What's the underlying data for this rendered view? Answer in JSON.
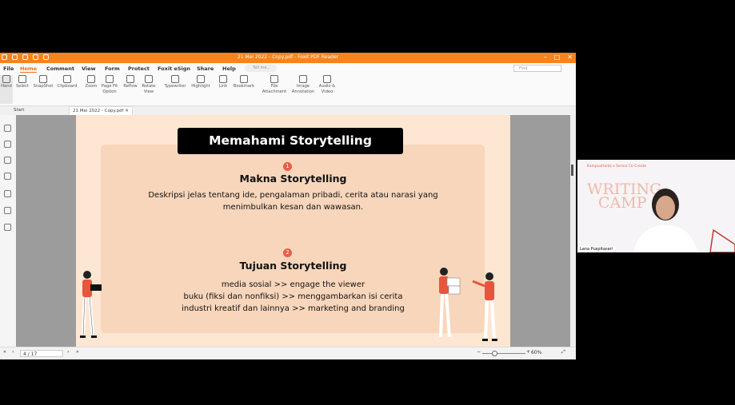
{
  "window": {
    "title": "21 Mei 2022 - Copy.pdf - Foxit PDF Reader"
  },
  "menu": {
    "items": [
      "File",
      "Home",
      "Comment",
      "View",
      "Form",
      "Protect",
      "Foxit eSign",
      "Share",
      "Help"
    ],
    "tell_me": "Tell me...",
    "find": "Find"
  },
  "ribbon": {
    "hand": "Hand",
    "select": "Select",
    "snapshot": "SnapShot",
    "clipboard": "Clipboard",
    "zoom": "Zoom",
    "page_fit": "Page Fit Option",
    "reflow": "Reflow",
    "rotate": "Rotate View",
    "typewriter": "Typewriter",
    "highlight": "Highlight",
    "link": "Link",
    "bookmark": "Bookmark",
    "file_attachment": "File Attachment",
    "image_annotation": "Image Annotation",
    "audio_video": "Audio & Video"
  },
  "tabs": {
    "start": "Start",
    "doc": "21 Mei 2022 - Copy.pdf"
  },
  "slide": {
    "title": "Memahami Storytelling",
    "section1": {
      "number": "1",
      "heading": "Makna Storytelling",
      "line1": "Deskripsi jelas tentang ide, pengalaman pribadi, cerita atau narasi yang",
      "line2": "menimbulkan kesan dan wawasan."
    },
    "section2": {
      "number": "2",
      "heading": "Tujuan Storytelling",
      "line1": "media sosial  >> engage the viewer",
      "line2": "buku (fiksi dan nonfiksi)  >>  menggambarkan isi cerita",
      "line3": "industri kreatif dan lainnya >>  marketing and branding"
    }
  },
  "status": {
    "page": "4 / 17",
    "zoom": "60%"
  },
  "video": {
    "name": "Lana Puspitasari",
    "poster_title_1": "WRITING",
    "poster_title_2": "CAMP",
    "poster_header": "KampusHaidz x Serica Co-Create"
  },
  "colors": {
    "brand_orange": "#f58420",
    "slide_bg": "#fde6d2",
    "panel": "#f8d6bb",
    "accent_red": "#e85d48"
  }
}
